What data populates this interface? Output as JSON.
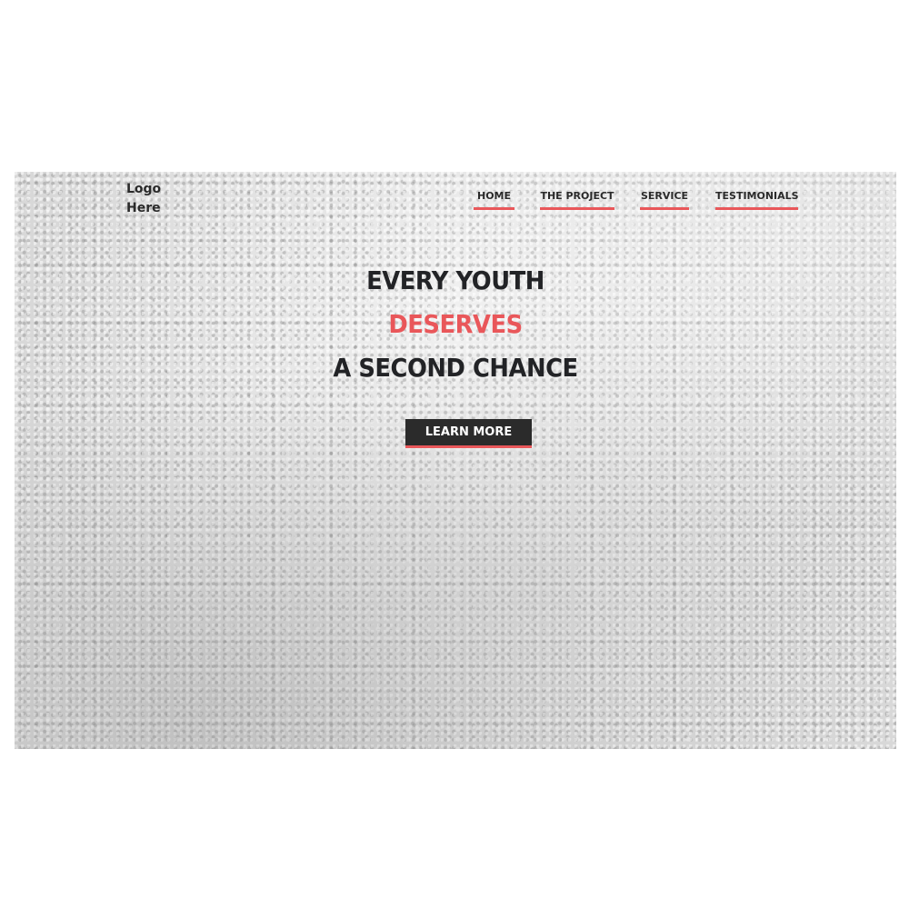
{
  "logo": {
    "line1": "Logo",
    "line2": "Here"
  },
  "nav": {
    "items": [
      {
        "label": "HOME"
      },
      {
        "label": "THE PROJECT"
      },
      {
        "label": "SERVICE"
      },
      {
        "label": "TESTIMONIALS"
      }
    ]
  },
  "hero": {
    "headline_line1": "EVERY YOUTH",
    "headline_line2": "DESERVES",
    "headline_line3": "A SECOND CHANCE",
    "cta_label": "LEARN MORE"
  },
  "colors": {
    "accent": "#e9575a",
    "text_dark": "#222326",
    "button_bg": "#2b2b2b",
    "background": "#dcdcdc"
  }
}
